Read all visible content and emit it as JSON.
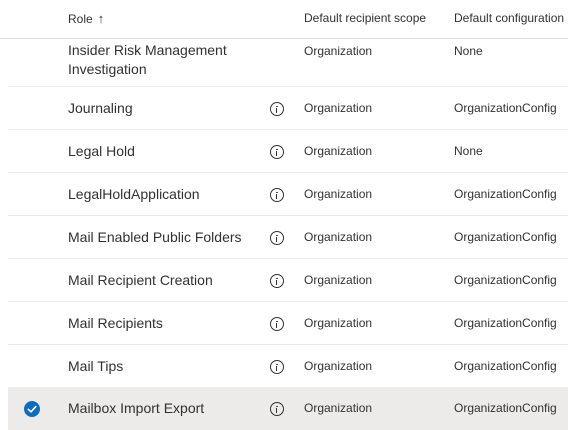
{
  "header": {
    "role_label": "Role",
    "sort_arrow": "↑",
    "scope_label": "Default recipient scope",
    "config_label": "Default configuration"
  },
  "rows": [
    {
      "name": "Insider Risk Management Investigation",
      "scope": "Organization",
      "config": "None",
      "info": false,
      "selected": false
    },
    {
      "name": "Journaling",
      "scope": "Organization",
      "config": "OrganizationConfig",
      "info": true,
      "selected": false
    },
    {
      "name": "Legal Hold",
      "scope": "Organization",
      "config": "None",
      "info": true,
      "selected": false
    },
    {
      "name": "LegalHoldApplication",
      "scope": "Organization",
      "config": "OrganizationConfig",
      "info": true,
      "selected": false
    },
    {
      "name": "Mail Enabled Public Folders",
      "scope": "Organization",
      "config": "OrganizationConfig",
      "info": true,
      "selected": false
    },
    {
      "name": "Mail Recipient Creation",
      "scope": "Organization",
      "config": "OrganizationConfig",
      "info": true,
      "selected": false
    },
    {
      "name": "Mail Recipients",
      "scope": "Organization",
      "config": "OrganizationConfig",
      "info": true,
      "selected": false
    },
    {
      "name": "Mail Tips",
      "scope": "Organization",
      "config": "OrganizationConfig",
      "info": true,
      "selected": false
    },
    {
      "name": "Mailbox Import Export",
      "scope": "Organization",
      "config": "OrganizationConfig",
      "info": true,
      "selected": true
    }
  ]
}
